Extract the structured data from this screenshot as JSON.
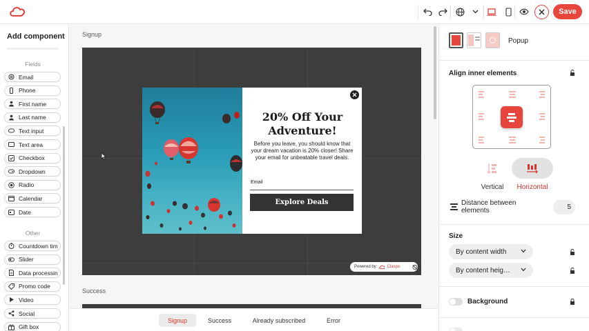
{
  "colors": {
    "accent": "#e8453c",
    "selected_tab_text": "#d8342c",
    "stage": "#3d3d3d"
  },
  "topbar": {
    "logo": "cloud-logo-icon",
    "icons": [
      "undo-icon",
      "redo-icon",
      "globe-icon",
      "chevron-down-icon",
      "laptop-icon",
      "mobile-icon",
      "eye-icon",
      "close-icon"
    ],
    "save_label": "Save"
  },
  "left_panel": {
    "title": "Add component",
    "fields_heading": "Fields",
    "fields": [
      {
        "label": "Email",
        "icon": "at-icon"
      },
      {
        "label": "Phone",
        "icon": "phone-icon"
      },
      {
        "label": "First name",
        "icon": "person-icon"
      },
      {
        "label": "Last name",
        "icon": "person-icon"
      },
      {
        "label": "Text input",
        "icon": "text-input-icon"
      },
      {
        "label": "Text area",
        "icon": "text-area-icon"
      },
      {
        "label": "Checkbox",
        "icon": "checkbox-icon"
      },
      {
        "label": "Dropdown",
        "icon": "dropdown-icon"
      },
      {
        "label": "Radio",
        "icon": "radio-icon"
      },
      {
        "label": "Calendar",
        "icon": "calendar-icon"
      },
      {
        "label": "Date",
        "icon": "date-icon"
      }
    ],
    "other_heading": "Other",
    "other": [
      {
        "label": "Countdown tim",
        "icon": "timer-icon"
      },
      {
        "label": "Slider",
        "icon": "slider-icon"
      },
      {
        "label": "Data processin",
        "icon": "document-icon"
      },
      {
        "label": "Promo code",
        "icon": "tag-icon"
      },
      {
        "label": "Video",
        "icon": "play-icon"
      },
      {
        "label": "Social",
        "icon": "share-icon"
      },
      {
        "label": "Gift box",
        "icon": "gift-icon"
      }
    ]
  },
  "canvas": {
    "signup_label": "Signup",
    "success_label": "Success",
    "popup": {
      "title": "20% Off Your Adventure!",
      "body": "Before you leave, you should know that your dream vacation is 20% closer! Share your email for unbeatable travel deals.",
      "email_label": "Email",
      "button_label": "Explore Deals",
      "powered_by": "Powered by",
      "brand": "Claspo"
    }
  },
  "bottom_tabs": [
    {
      "label": "Signup",
      "active": true
    },
    {
      "label": "Success",
      "active": false
    },
    {
      "label": "Already subscribed",
      "active": false
    },
    {
      "label": "Error",
      "active": false
    }
  ],
  "right_panel": {
    "popup_label": "Popup",
    "align_heading": "Align inner elements",
    "vertical_label": "Vertical",
    "horizontal_label": "Horizontal",
    "distance_label": "Distance between elements",
    "distance_value": "5",
    "size_heading": "Size",
    "width_option": "By content width",
    "height_option": "By content heig…",
    "background_label": "Background"
  }
}
